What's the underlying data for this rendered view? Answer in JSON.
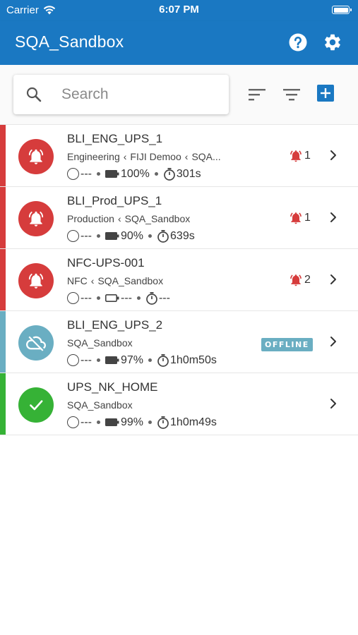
{
  "status_bar": {
    "carrier": "Carrier",
    "time": "6:07 PM"
  },
  "app_bar": {
    "title": "SQA_Sandbox"
  },
  "search": {
    "placeholder": "Search",
    "value": ""
  },
  "devices": [
    {
      "name": "BLI_ENG_UPS_1",
      "path": [
        "Engineering",
        "FIJI Demoo",
        "SQA..."
      ],
      "status": "alarm",
      "load": "---",
      "battery": "100%",
      "runtime": "301s",
      "alarm_count": "1",
      "stripe_color": "#d63c3c",
      "avatar_color": "#d63c3c"
    },
    {
      "name": "BLI_Prod_UPS_1",
      "path": [
        "Production",
        "SQA_Sandbox"
      ],
      "status": "alarm",
      "load": "---",
      "battery": "90%",
      "runtime": "639s",
      "alarm_count": "1",
      "stripe_color": "#d63c3c",
      "avatar_color": "#d63c3c"
    },
    {
      "name": "NFC-UPS-001",
      "path": [
        "NFC",
        "SQA_Sandbox"
      ],
      "status": "alarm",
      "load": "---",
      "battery": "---",
      "runtime": "---",
      "alarm_count": "2",
      "stripe_color": "#d63c3c",
      "avatar_color": "#d63c3c"
    },
    {
      "name": "BLI_ENG_UPS_2",
      "path": [
        "SQA_Sandbox"
      ],
      "status": "offline",
      "badge": "OFFLINE",
      "load": "---",
      "battery": "97%",
      "runtime": "1h0m50s",
      "stripe_color": "#6aaec2",
      "avatar_color": "#6aaec2"
    },
    {
      "name": "UPS_NK_HOME",
      "path": [
        "SQA_Sandbox"
      ],
      "status": "ok",
      "load": "---",
      "battery": "99%",
      "runtime": "1h0m49s",
      "stripe_color": "#36b236",
      "avatar_color": "#36b236"
    }
  ],
  "icons": {
    "alarm": "bell-alarm-icon",
    "offline": "cloud-off-icon",
    "ok": "check-icon",
    "help": "help-circle-icon",
    "settings": "gear-icon",
    "sort": "sort-icon",
    "filter": "filter-icon",
    "add": "add-box-icon"
  },
  "colors": {
    "primary": "#1a78c2",
    "alarm": "#d63c3c",
    "offline": "#6aaec2",
    "ok": "#36b236"
  }
}
